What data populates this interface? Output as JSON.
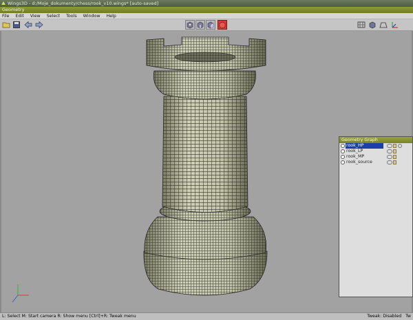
{
  "window": {
    "title": "Wings3D - d:/Moje_dokumenty/chess/rook_v10.wings* [auto-saved]"
  },
  "geometry_tab": {
    "label": "Geometry"
  },
  "menu": [
    "File",
    "Edit",
    "View",
    "Select",
    "Tools",
    "Window",
    "Help"
  ],
  "toolbar": {
    "left_icons": [
      "open-folder-icon",
      "save-icon",
      "undo-arrow-icon",
      "redo-arrow-icon"
    ],
    "selection_modes": [
      "vertex-mode",
      "edge-mode",
      "face-mode",
      "body-mode"
    ],
    "active_selection_mode": "body-mode",
    "right_icons": [
      "wireframe-icon",
      "smooth-shade-icon",
      "perspective-icon",
      "axes-icon"
    ]
  },
  "geometry_graph": {
    "title": "Geometry Graph",
    "objects": [
      {
        "name": "rook_HP",
        "selected": true
      },
      {
        "name": "rook_LP",
        "selected": false
      },
      {
        "name": "rook_MP",
        "selected": false
      },
      {
        "name": "rook_source",
        "selected": false
      }
    ]
  },
  "statusbar": {
    "left": "L: Select  M: Start camera  R: Show menu  [Ctrl]+R: Tweak menu",
    "right": [
      "Tweak: Disabled",
      "Tw"
    ]
  },
  "colors": {
    "viewport": "#a2a2a2",
    "mesh_fill": "#c9c9b0",
    "mesh_wire": "#2a2a22",
    "active_mode": "#d63b34",
    "selection": "#1a3fa8"
  }
}
